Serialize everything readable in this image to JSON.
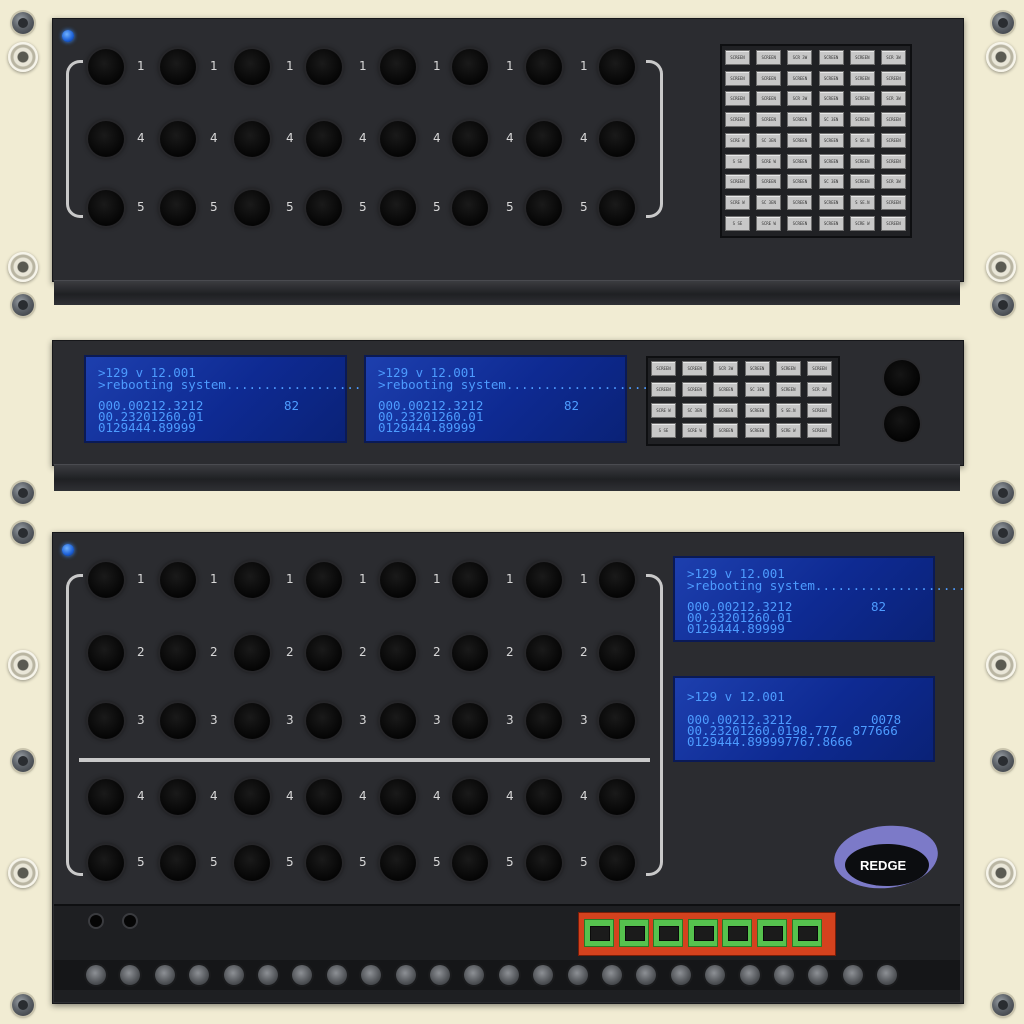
{
  "unit1": {
    "row_labels": [
      "1",
      "4",
      "5"
    ],
    "button_rows": [
      [
        "SCREEN",
        "SCREEN",
        "SCR 3W",
        "SCREEN",
        "SCREEN",
        "SCR 3W"
      ],
      [
        "SCREEN",
        "SCREEN",
        "SCREEN",
        "SCREEN",
        "SCREEN",
        "SCREEN"
      ],
      [
        "SCREEN",
        "SCREEN",
        "SCR 3W",
        "SCREEN",
        "SCREEN",
        "SCR 3W"
      ],
      [
        "SCREEN",
        "SCREEN",
        "SCREEN",
        "SC 3EN",
        "SCREEN",
        "SCREEN"
      ],
      [
        "SCRE W",
        "SC 3EN",
        "SCREEN",
        "SCREEN",
        "S SE.N",
        "SCREEN"
      ],
      [
        "S SE",
        "SCRE W",
        "SCREEN",
        "SCREEN",
        "SCREEN",
        "SCREEN"
      ],
      [
        "SCREEN",
        "SCREEN",
        "SCREEN",
        "SC 3EN",
        "SCREEN",
        "SCR 3W"
      ],
      [
        "SCRE W",
        "SC 3EN",
        "SCREEN",
        "SCREEN",
        "S SE.N",
        "SCREEN"
      ],
      [
        "S SE",
        "SCRE W",
        "SCREEN",
        "SCREEN",
        "SCRE W",
        "SCREEN"
      ]
    ]
  },
  "unit2": {
    "lcd": {
      "line1": ">129 v 12.001",
      "line2": ">rebooting system....................",
      "line3": "000.00212.3212",
      "line3_value": "82",
      "line4": "00.23201260.01",
      "line5": "0129444.89999"
    },
    "button_rows": [
      [
        "SCREEN",
        "SCREEN",
        "SCR 3W",
        "SCREEN",
        "SCREEN",
        "SCREEN"
      ],
      [
        "SCREEN",
        "SCREEN",
        "SCREEN",
        "SC 3EN",
        "SCREEN",
        "SCR 3W"
      ],
      [
        "SCRE W",
        "SC 3EN",
        "SCREEN",
        "SCREEN",
        "S SE.N",
        "SCREEN"
      ],
      [
        "S SE",
        "SCRE W",
        "SCREEN",
        "SCREEN",
        "SCRE W",
        "SCREEN"
      ]
    ]
  },
  "unit3": {
    "row_labels": [
      "1",
      "2",
      "3",
      "4",
      "5"
    ],
    "lcd_top": {
      "line1": ">129 v 12.001",
      "line2": ">rebooting system....................",
      "line3": "000.00212.3212",
      "line3_value": "82",
      "line4": "00.23201260.01",
      "line5": "0129444.89999"
    },
    "lcd_bottom": {
      "line1": ">129 v 12.001",
      "line3": "000.00212.3212",
      "line3_value": "0078",
      "line4": "00.23201260.0198.777  877666",
      "line5": "0129444.899997767.8666"
    },
    "logo_text": "REDGE"
  },
  "colors": {
    "panel": "#2b2c30",
    "rack": "#f1ecd3",
    "led": "#1c5fd6",
    "lcd": "#0e2a92",
    "lcd_text": "#4d9cff",
    "ethernet_block": "#d4421e",
    "ethernet_port": "#56c24e",
    "logo": "#7c7ac8"
  }
}
